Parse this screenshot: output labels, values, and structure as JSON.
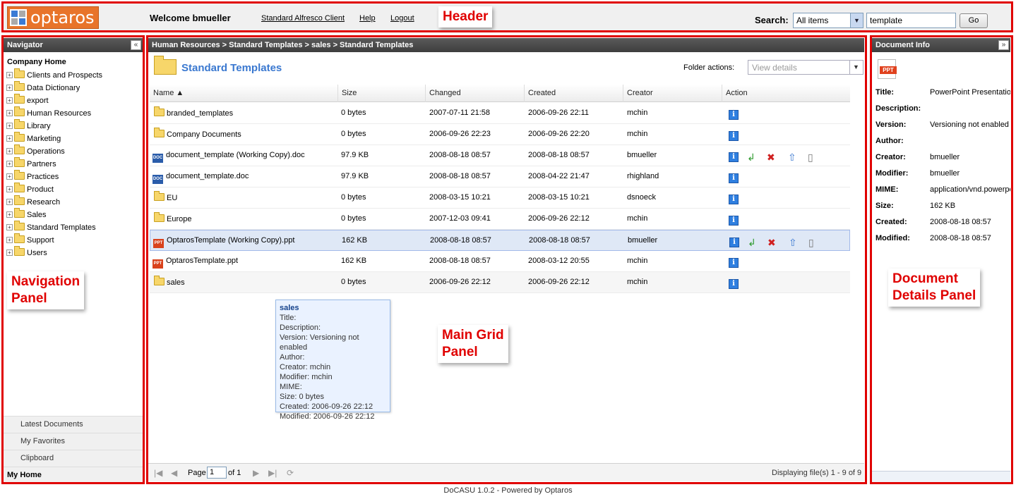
{
  "header": {
    "logo_text": "optaros",
    "welcome": "Welcome bmueller",
    "links": [
      "Standard Alfresco Client",
      "Help",
      "Logout"
    ],
    "search_label": "Search:",
    "search_scope": "All items",
    "search_value": "template",
    "go_label": "Go",
    "annotation": "Header"
  },
  "navigator": {
    "title": "Navigator",
    "collapse_glyph": "«",
    "home": "Company Home",
    "items": [
      "Clients and Prospects",
      "Data Dictionary",
      "export",
      "Human Resources",
      "Library",
      "Marketing",
      "Operations",
      "Partners",
      "Practices",
      "Product",
      "Research",
      "Sales",
      "Standard Templates",
      "Support",
      "Users"
    ],
    "bottom": [
      "Latest Documents",
      "My Favorites",
      "Clipboard"
    ],
    "my_home": "My Home",
    "annotation_1": "Navigation",
    "annotation_2": "Panel"
  },
  "main": {
    "breadcrumb": "Human Resources > Standard Templates > sales > Standard Templates",
    "folder_title": "Standard Templates",
    "folder_actions_label": "Folder actions:",
    "view_select": "View details",
    "columns": [
      "Name ▲",
      "Size",
      "Changed",
      "Created",
      "Creator",
      "Action"
    ],
    "rows": [
      {
        "name": "branded_templates",
        "size": "0 bytes",
        "changed": "2007-07-11 21:58",
        "created": "2006-09-26 22:11",
        "creator": "mchin"
      },
      {
        "name": "Company Documents",
        "size": "0 bytes",
        "changed": "2006-09-26 22:23",
        "created": "2006-09-26 22:20",
        "creator": "mchin"
      },
      {
        "name": "document_template (Working Copy).doc",
        "size": "97.9 KB",
        "changed": "2008-08-18 08:57",
        "created": "2008-08-18 08:57",
        "creator": "bmueller"
      },
      {
        "name": "document_template.doc",
        "size": "97.9 KB",
        "changed": "2008-08-18 08:57",
        "created": "2008-04-22 21:47",
        "creator": "rhighland"
      },
      {
        "name": "EU",
        "size": "0 bytes",
        "changed": "2008-03-15 10:21",
        "created": "2008-03-15 10:21",
        "creator": "dsnoeck"
      },
      {
        "name": "Europe",
        "size": "0 bytes",
        "changed": "2007-12-03 09:41",
        "created": "2006-09-26 22:12",
        "creator": "mchin"
      },
      {
        "name": "OptarosTemplate (Working Copy).ppt",
        "size": "162 KB",
        "changed": "2008-08-18 08:57",
        "created": "2008-08-18 08:57",
        "creator": "bmueller"
      },
      {
        "name": "OptarosTemplate.ppt",
        "size": "162 KB",
        "changed": "2008-08-18 08:57",
        "created": "2008-03-12 20:55",
        "creator": "mchin"
      },
      {
        "name": "sales",
        "size": "0 bytes",
        "changed": "2006-09-26 22:12",
        "created": "2006-09-26 22:12",
        "creator": "mchin"
      }
    ],
    "doc_badge": "DOC",
    "ppt_badge": "PPT",
    "info_glyph": "i",
    "tooltip": {
      "title": "sales",
      "lines": [
        "Title:",
        "Description:",
        "Version: Versioning not enabled",
        "Author:",
        "Creator: mchin",
        "Modifier: mchin",
        "MIME:",
        "Size: 0 bytes",
        "Created: 2006-09-26 22:12",
        "Modified: 2006-09-26 22:12"
      ]
    },
    "pager": {
      "page_label": "Page",
      "page_value": "1",
      "of_label": "of 1",
      "display_text": "Displaying file(s) 1 - 9 of 9"
    },
    "annotation_1": "Main Grid",
    "annotation_2": "Panel"
  },
  "doc_info": {
    "title": "Document Info",
    "collapse_glyph": "»",
    "file_badge": "PPT",
    "fields": [
      {
        "label": "Title:",
        "value": "PowerPoint Presentation"
      },
      {
        "label": "Description:",
        "value": ""
      },
      {
        "label": "Version:",
        "value": "Versioning not enabled"
      },
      {
        "label": "Author:",
        "value": ""
      },
      {
        "label": "Creator:",
        "value": "bmueller"
      },
      {
        "label": "Modifier:",
        "value": "bmueller"
      },
      {
        "label": "MIME:",
        "value": "application/vnd.powerpoint"
      },
      {
        "label": "Size:",
        "value": "162 KB"
      },
      {
        "label": "Created:",
        "value": "2008-08-18 08:57"
      },
      {
        "label": "Modified:",
        "value": "2008-08-18 08:57"
      }
    ],
    "annotation_1": "Document",
    "annotation_2": "Details Panel"
  },
  "footer": "DoCASU 1.0.2 - Powered by Optaros",
  "colors": {
    "annotation": "#e00000",
    "accent": "#3a78d0",
    "info_icon": "#2f7fe0"
  }
}
